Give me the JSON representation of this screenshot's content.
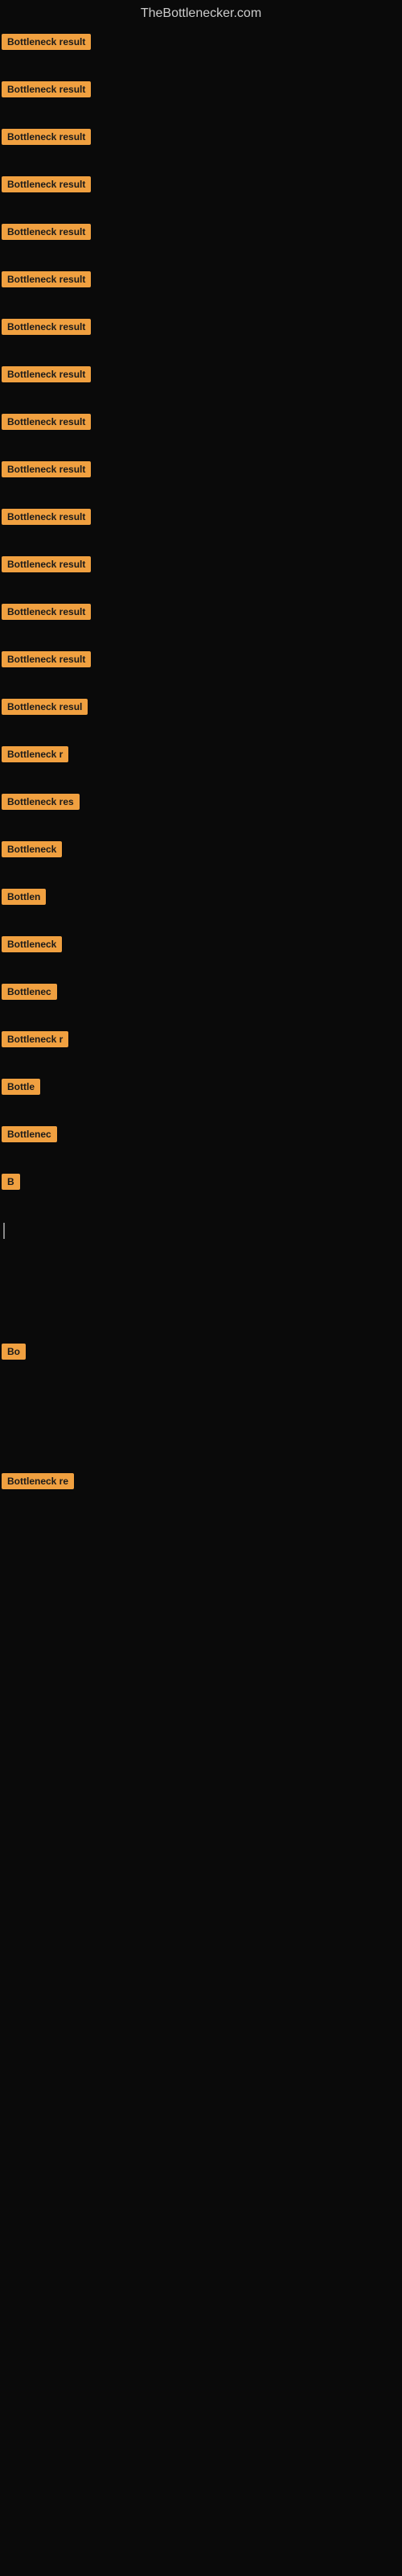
{
  "site": {
    "title": "TheBottlenecker.com"
  },
  "items": [
    {
      "label": "Bottleneck result",
      "visible_chars": 16
    },
    {
      "label": "Bottleneck result",
      "visible_chars": 16
    },
    {
      "label": "Bottleneck result",
      "visible_chars": 16
    },
    {
      "label": "Bottleneck result",
      "visible_chars": 16
    },
    {
      "label": "Bottleneck result",
      "visible_chars": 16
    },
    {
      "label": "Bottleneck result",
      "visible_chars": 16
    },
    {
      "label": "Bottleneck result",
      "visible_chars": 16
    },
    {
      "label": "Bottleneck result",
      "visible_chars": 16
    },
    {
      "label": "Bottleneck result",
      "visible_chars": 16
    },
    {
      "label": "Bottleneck result",
      "visible_chars": 16
    },
    {
      "label": "Bottleneck result",
      "visible_chars": 16
    },
    {
      "label": "Bottleneck result",
      "visible_chars": 16
    },
    {
      "label": "Bottleneck result",
      "visible_chars": 16
    },
    {
      "label": "Bottleneck result",
      "visible_chars": 16
    },
    {
      "label": "Bottleneck resul",
      "visible_chars": 15
    },
    {
      "label": "Bottleneck r",
      "visible_chars": 12
    },
    {
      "label": "Bottleneck res",
      "visible_chars": 14
    },
    {
      "label": "Bottleneck",
      "visible_chars": 10
    },
    {
      "label": "Bottlen",
      "visible_chars": 7
    },
    {
      "label": "Bottleneck",
      "visible_chars": 10
    },
    {
      "label": "Bottlenec",
      "visible_chars": 9
    },
    {
      "label": "Bottleneck r",
      "visible_chars": 12
    },
    {
      "label": "Bottle",
      "visible_chars": 6
    },
    {
      "label": "Bottlenec",
      "visible_chars": 9
    },
    {
      "label": "B",
      "visible_chars": 1
    },
    {
      "label": "|",
      "visible_chars": 1,
      "is_cursor": true
    },
    {
      "label": "",
      "visible_chars": 0,
      "empty": true
    },
    {
      "label": "",
      "visible_chars": 0,
      "empty": true
    },
    {
      "label": "Bo",
      "visible_chars": 2
    },
    {
      "label": "",
      "visible_chars": 0,
      "empty": true
    },
    {
      "label": "",
      "visible_chars": 0,
      "empty": true
    },
    {
      "label": "",
      "visible_chars": 0,
      "empty": true
    },
    {
      "label": "Bottleneck re",
      "visible_chars": 13
    },
    {
      "label": "",
      "visible_chars": 0,
      "empty": true
    },
    {
      "label": "",
      "visible_chars": 0,
      "empty": true
    },
    {
      "label": "",
      "visible_chars": 0,
      "empty": true
    }
  ]
}
